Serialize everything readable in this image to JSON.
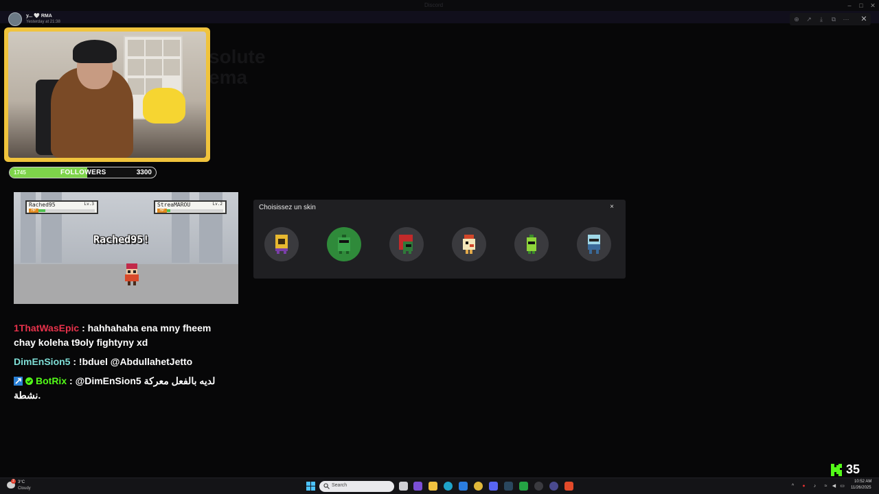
{
  "background_window": {
    "title": "Discord",
    "ghost_heading": "solute\nema"
  },
  "user_tag": {
    "name": "y... 🤍 RMA",
    "time": "Yesterday at 21:38"
  },
  "followers": {
    "current": "1745",
    "label": "FOLLOWERS",
    "goal": "3300",
    "progress": 0.53
  },
  "game": {
    "player": {
      "name": "Rached95",
      "level": "Lv.3",
      "hp_tag": "HP",
      "hp": 0.25
    },
    "opponent": {
      "name": "StreaMAROU",
      "level": "Lv.2",
      "hp_tag": "HP",
      "hp": 0.2
    },
    "battle_text": "Rached95!"
  },
  "chat": [
    {
      "user": "1ThatWasEpic",
      "user_color": "#e8324b",
      "message": ": hahhahaha ena mny fheem chay koleha t9oly fightyny xd"
    },
    {
      "user": "DimEnSion5",
      "user_color": "#7fe0d8",
      "message": ": !bduel @AbdullahetJetto"
    },
    {
      "user": "BotRix",
      "user_color": "#53fc18",
      "message": ": @DimEnSion5 لديه بالفعل معركة نشطة.",
      "badges": [
        "bot-badge-icon",
        "verified-badge-icon"
      ]
    }
  ],
  "modal": {
    "title": "Choisissez un skin",
    "close_glyph": "×",
    "skins": [
      {
        "name": "skin-yellow-knight",
        "selected": false,
        "colors": [
          "#e7b830",
          "#7a3fa8"
        ]
      },
      {
        "name": "skin-green-robot",
        "selected": true,
        "colors": [
          "#3aa34a",
          "#1c5a24"
        ]
      },
      {
        "name": "skin-red-hair",
        "selected": false,
        "colors": [
          "#c22a2a",
          "#2f7a3a"
        ]
      },
      {
        "name": "skin-white-bird",
        "selected": false,
        "colors": [
          "#f3e6b8",
          "#d2472a"
        ]
      },
      {
        "name": "skin-green-slime",
        "selected": false,
        "colors": [
          "#8ed53a",
          "#3a8a2a"
        ]
      },
      {
        "name": "skin-blue-ghost",
        "selected": false,
        "colors": [
          "#9fd8e8",
          "#3a6a9a"
        ]
      }
    ]
  },
  "kick": {
    "count": "35",
    "brand_color": "#53fc18"
  },
  "taskbar": {
    "weather_temp": "3°C",
    "weather_cond": "Cloudy",
    "notifications": "2",
    "search_placeholder": "Search",
    "time": "10:52 AM",
    "date": "11/26/2025",
    "apps": [
      "file-explorer-icon",
      "task-view-icon",
      "obsidian-icon",
      "folder-icon",
      "edge-icon",
      "mail-icon",
      "chrome-icon",
      "discord-icon",
      "steam-icon",
      "whatsapp-icon",
      "obs-icon",
      "browser-icon",
      "brave-icon"
    ]
  }
}
